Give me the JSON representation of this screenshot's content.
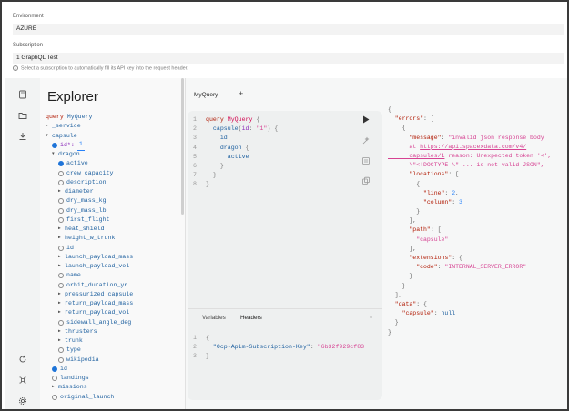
{
  "environment": {
    "label": "Environment",
    "value": "AZURE"
  },
  "subscription": {
    "label": "Subscription",
    "value": "1 GraphQL Test",
    "hint": "Select a subscription to automatically fill its API key into the request header."
  },
  "explorer": {
    "title": "Explorer",
    "query_keyword": "query",
    "query_name": "MyQuery",
    "arg_value": "1",
    "rows": [
      {
        "indent": 0,
        "kind": "toggle",
        "label": "_service",
        "state": "closed"
      },
      {
        "indent": 0,
        "kind": "toggle",
        "label": "capsule",
        "state": "open"
      },
      {
        "indent": 1,
        "kind": "argcb",
        "label": "id*:",
        "checked": true
      },
      {
        "indent": 1,
        "kind": "toggle",
        "label": "dragon",
        "state": "open"
      },
      {
        "indent": 2,
        "kind": "cb",
        "label": "active",
        "checked": true
      },
      {
        "indent": 2,
        "kind": "cb",
        "label": "crew_capacity",
        "checked": false
      },
      {
        "indent": 2,
        "kind": "cb",
        "label": "description",
        "checked": false
      },
      {
        "indent": 2,
        "kind": "toggle",
        "label": "diameter",
        "state": "closed"
      },
      {
        "indent": 2,
        "kind": "cb",
        "label": "dry_mass_kg",
        "checked": false
      },
      {
        "indent": 2,
        "kind": "cb",
        "label": "dry_mass_lb",
        "checked": false
      },
      {
        "indent": 2,
        "kind": "cb",
        "label": "first_flight",
        "checked": false
      },
      {
        "indent": 2,
        "kind": "toggle",
        "label": "heat_shield",
        "state": "closed"
      },
      {
        "indent": 2,
        "kind": "toggle",
        "label": "height_w_trunk",
        "state": "closed"
      },
      {
        "indent": 2,
        "kind": "cb",
        "label": "id",
        "checked": false
      },
      {
        "indent": 2,
        "kind": "toggle",
        "label": "launch_payload_mass",
        "state": "closed"
      },
      {
        "indent": 2,
        "kind": "toggle",
        "label": "launch_payload_vol",
        "state": "closed"
      },
      {
        "indent": 2,
        "kind": "cb",
        "label": "name",
        "checked": false
      },
      {
        "indent": 2,
        "kind": "cb",
        "label": "orbit_duration_yr",
        "checked": false
      },
      {
        "indent": 2,
        "kind": "toggle",
        "label": "pressurized_capsule",
        "state": "closed"
      },
      {
        "indent": 2,
        "kind": "toggle",
        "label": "return_payload_mass",
        "state": "closed"
      },
      {
        "indent": 2,
        "kind": "toggle",
        "label": "return_payload_vol",
        "state": "closed"
      },
      {
        "indent": 2,
        "kind": "cb",
        "label": "sidewall_angle_deg",
        "checked": false
      },
      {
        "indent": 2,
        "kind": "toggle",
        "label": "thrusters",
        "state": "closed"
      },
      {
        "indent": 2,
        "kind": "toggle",
        "label": "trunk",
        "state": "closed"
      },
      {
        "indent": 2,
        "kind": "cb",
        "label": "type",
        "checked": false
      },
      {
        "indent": 2,
        "kind": "cb",
        "label": "wikipedia",
        "checked": false
      },
      {
        "indent": 1,
        "kind": "cb",
        "label": "id",
        "checked": true
      },
      {
        "indent": 1,
        "kind": "cb",
        "label": "landings",
        "checked": false
      },
      {
        "indent": 1,
        "kind": "toggle",
        "label": "missions",
        "state": "closed"
      },
      {
        "indent": 1,
        "kind": "cb",
        "label": "original_launch",
        "checked": false
      }
    ]
  },
  "tabs": {
    "active": "MyQuery",
    "add": "+"
  },
  "editor": {
    "lines": [
      {
        "n": "1",
        "parts": [
          [
            "kw",
            "query "
          ],
          [
            "name",
            "MyQuery"
          ],
          [
            "pun",
            " {"
          ]
        ]
      },
      {
        "n": "2",
        "parts": [
          [
            "fld",
            "  capsule"
          ],
          [
            "pun",
            "("
          ],
          [
            "attr",
            "id"
          ],
          [
            "pun",
            ": "
          ],
          [
            "str",
            "\"1\""
          ],
          [
            "pun",
            ") {"
          ]
        ]
      },
      {
        "n": "3",
        "parts": [
          [
            "fld",
            "    id"
          ]
        ]
      },
      {
        "n": "4",
        "parts": [
          [
            "fld",
            "    dragon"
          ],
          [
            "pun",
            " {"
          ]
        ]
      },
      {
        "n": "5",
        "parts": [
          [
            "fld",
            "      active"
          ]
        ]
      },
      {
        "n": "6",
        "parts": [
          [
            "pun",
            "    }"
          ]
        ]
      },
      {
        "n": "7",
        "parts": [
          [
            "pun",
            "  }"
          ]
        ]
      },
      {
        "n": "8",
        "parts": [
          [
            "pun",
            "}"
          ]
        ]
      }
    ]
  },
  "variables": {
    "tab_variables": "Variables",
    "tab_headers": "Headers",
    "lines": [
      {
        "n": "1",
        "parts": [
          [
            "pun",
            "{"
          ]
        ]
      },
      {
        "n": "2",
        "parts": [
          [
            "prop",
            "  \"Ocp-Apim-Subscription-Key\""
          ],
          [
            "pun",
            ": "
          ],
          [
            "str",
            "\"6b32f929cf83"
          ]
        ]
      },
      {
        "n": "3",
        "parts": [
          [
            "pun",
            "}"
          ]
        ]
      }
    ]
  },
  "result": {
    "lines": [
      [
        [
          "pun",
          "{"
        ]
      ],
      [
        [
          "key",
          "  \"errors\""
        ],
        [
          "pun",
          ": ["
        ]
      ],
      [
        [
          "pun",
          "    {"
        ]
      ],
      [
        [
          "key",
          "      \"message\""
        ],
        [
          "pun",
          ": "
        ],
        [
          "s",
          "\"invalid json response body"
        ]
      ],
      [
        [
          "s",
          "      at "
        ],
        [
          "link",
          "https://api.spacexdata.com/v4/"
        ]
      ],
      [
        [
          "link",
          "      capsules/1"
        ],
        [
          "s",
          " reason: Unexpected token '<',"
        ]
      ],
      [
        [
          "s",
          "      \\\"<!DOCTYPE \\\" ... is not valid JSON\","
        ]
      ],
      [
        [
          "key",
          "      \"locations\""
        ],
        [
          "pun",
          ": ["
        ]
      ],
      [
        [
          "pun",
          "        {"
        ]
      ],
      [
        [
          "key",
          "          \"line\""
        ],
        [
          "pun",
          ": "
        ],
        [
          "n",
          "2"
        ],
        [
          "pun",
          ","
        ]
      ],
      [
        [
          "key",
          "          \"column\""
        ],
        [
          "pun",
          ": "
        ],
        [
          "n",
          "3"
        ]
      ],
      [
        [
          "pun",
          "        }"
        ]
      ],
      [
        [
          "pun",
          "      ],"
        ]
      ],
      [
        [
          "key",
          "      \"path\""
        ],
        [
          "pun",
          ": ["
        ]
      ],
      [
        [
          "s",
          "        \"capsule\""
        ]
      ],
      [
        [
          "pun",
          "      ],"
        ]
      ],
      [
        [
          "key",
          "      \"extensions\""
        ],
        [
          "pun",
          ": {"
        ]
      ],
      [
        [
          "key",
          "        \"code\""
        ],
        [
          "pun",
          ": "
        ],
        [
          "s",
          "\"INTERNAL_SERVER_ERROR\""
        ]
      ],
      [
        [
          "pun",
          "      }"
        ]
      ],
      [
        [
          "pun",
          "    }"
        ]
      ],
      [
        [
          "pun",
          "  ],"
        ]
      ],
      [
        [
          "key",
          "  \"data\""
        ],
        [
          "pun",
          ": {"
        ]
      ],
      [
        [
          "key",
          "    \"capsule\""
        ],
        [
          "pun",
          ": "
        ],
        [
          "kw",
          "null"
        ]
      ],
      [
        [
          "pun",
          "  }"
        ]
      ],
      [
        [
          "pun",
          "}"
        ]
      ]
    ]
  },
  "icons": {
    "rail": [
      "file-icon",
      "folder-icon",
      "download-icon",
      "refresh-icon",
      "shortcut-icon",
      "settings-icon"
    ],
    "editor_tools": [
      "run-icon",
      "prettify-icon",
      "merge-icon",
      "copy-icon"
    ],
    "vars_chevron": "chevron-down-icon"
  },
  "text_cursor": "I"
}
